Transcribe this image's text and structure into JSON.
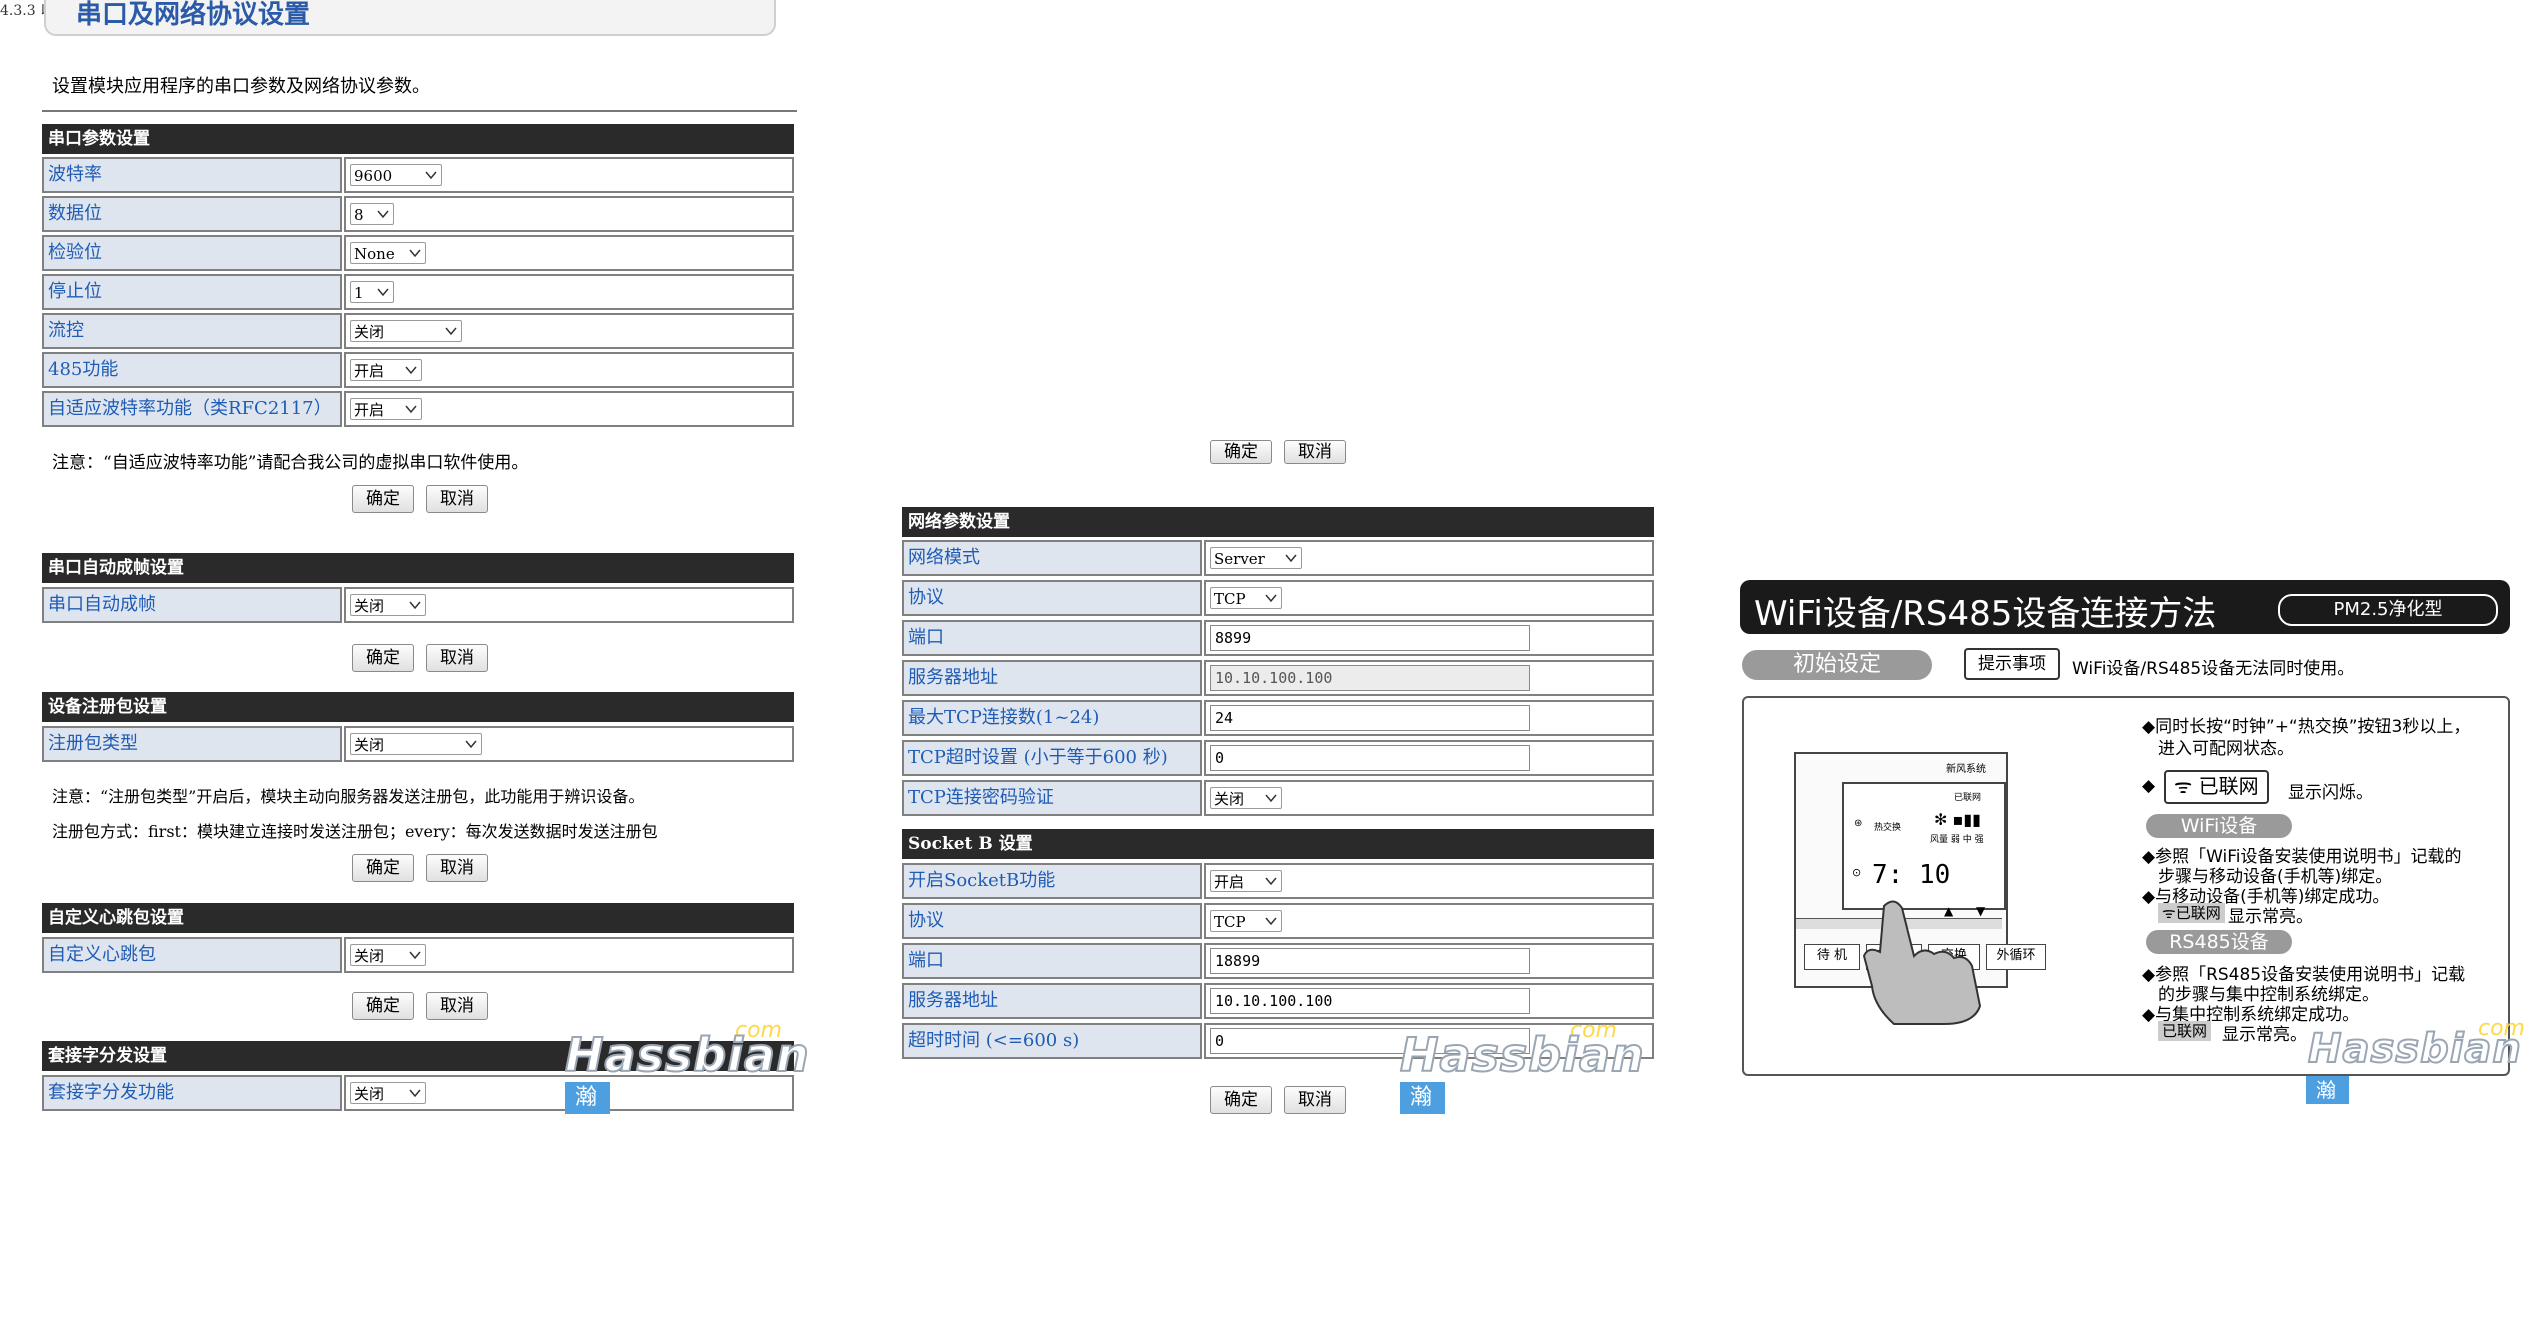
{
  "top_caption": "4.3.3 以下为设置串口及网络协议的截图：",
  "left": {
    "title": "串口及网络协议设置",
    "description": "设置模块应用程序的串口参数及网络协议参数。",
    "serial_section": "串口参数设置",
    "serial_rows": [
      {
        "label": "波特率",
        "value": "9600"
      },
      {
        "label": "数据位",
        "value": "8"
      },
      {
        "label": "检验位",
        "value": "None"
      },
      {
        "label": "停止位",
        "value": "1"
      },
      {
        "label": "流控",
        "value": "关闭"
      },
      {
        "label": "485功能",
        "value": "开启"
      },
      {
        "label": "自适应波特率功能（类RFC2117）",
        "value": "开启"
      }
    ],
    "serial_note": "注意：“自适应波特率功能”请配合我公司的虚拟串口软件使用。",
    "ok": "确定",
    "cancel": "取消",
    "autoframe_section": "串口自动成帧设置",
    "autoframe_label": "串口自动成帧",
    "autoframe_value": "关闭",
    "reg_section": "设备注册包设置",
    "reg_label": "注册包类型",
    "reg_value": "关闭",
    "reg_note1": "注意：“注册包类型”开启后，模块主动向服务器发送注册包，此功能用于辨识设备。",
    "reg_note2": "注册包方式：first：模块建立连接时发送注册包；every：每次发送数据时发送注册包",
    "hb_section": "自定义心跳包设置",
    "hb_label": "自定义心跳包",
    "hb_value": "关闭",
    "sock_section": "套接字分发设置",
    "sock_label": "套接字分发功能",
    "sock_value": "关闭"
  },
  "middle": {
    "ok": "确定",
    "cancel": "取消",
    "net_section": "网络参数设置",
    "net_rows": [
      {
        "label": "网络模式",
        "value": "Server",
        "type": "select"
      },
      {
        "label": "协议",
        "value": "TCP",
        "type": "select"
      },
      {
        "label": "端口",
        "value": "8899",
        "type": "input"
      },
      {
        "label": "服务器地址",
        "value": "10.10.100.100",
        "type": "disabled"
      },
      {
        "label": "最大TCP连接数(1~24)",
        "value": "24",
        "type": "input"
      },
      {
        "label": "TCP超时设置 (小于等于600 秒)",
        "value": "0",
        "type": "input"
      },
      {
        "label": "TCP连接密码验证",
        "value": "关闭",
        "type": "select"
      }
    ],
    "sockb_section": "Socket B 设置",
    "sockb_rows": [
      {
        "label": "开启SocketB功能",
        "value": "开启",
        "type": "select"
      },
      {
        "label": "协议",
        "value": "TCP",
        "type": "select"
      },
      {
        "label": "端口",
        "value": "18899",
        "type": "input"
      },
      {
        "label": "服务器地址",
        "value": "10.10.100.100",
        "type": "input"
      },
      {
        "label": "超时时间 (<=600 s)",
        "value": "0",
        "type": "input"
      }
    ]
  },
  "watermark": {
    "brand": "Hassbian",
    "com": "com",
    "forum": "瀚思彼岸技术论坛"
  },
  "manual": {
    "title": "WiFi设备/RS485设备连接方法",
    "badge": "PM2.5净化型",
    "init": "初始设定",
    "tip_label": "提示事项",
    "tip_text": "WiFi设备/RS485设备无法同时使用。",
    "step1": "◆同时长按“时钟”+“热交换”按钮3秒以上，",
    "step1b": "进入可配网状态。",
    "connected": "已联网",
    "flash": "显示闪烁。",
    "wifi_title": "WiFi设备",
    "wifi1": "◆参照「WiFi设备安装使用说明书」记载的",
    "wifi1b": "步骤与移动设备(手机等)绑定。",
    "wifi2": "◆与移动设备(手机等)绑定成功。",
    "wifi3": "显示常亮。",
    "rs_title": "RS485设备",
    "rs1": "◆参照「RS485设备安装使用说明书」记载",
    "rs1b": "的步骤与集中控制系统绑定。",
    "rs2": "◆与集中控制系统绑定成功。",
    "rs3": "显示常亮。",
    "device_brand": "新风系统",
    "screen_connected": "已联网",
    "screen_heat": "热交换",
    "screen_fan": "风量 弱 中 强",
    "screen_time": "7: 10",
    "btn_standby": "待 机",
    "btn_inner": "内循环",
    "btn_swap": "交换",
    "btn_outer": "外循环"
  }
}
